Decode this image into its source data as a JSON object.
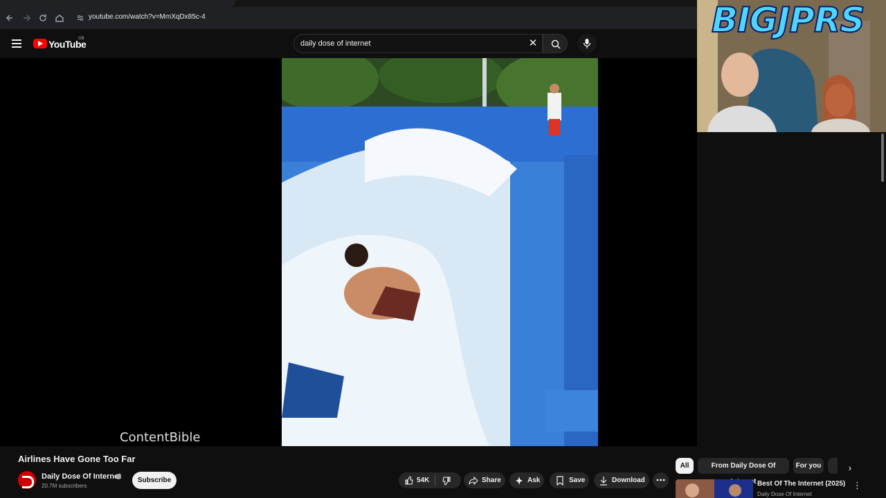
{
  "browser": {
    "url": "youtube.com/watch?v=MmXqDx85c-4",
    "icons": [
      "back-icon",
      "forward-icon",
      "reload-icon",
      "home-icon",
      "site-info-icon"
    ]
  },
  "header": {
    "logo_text": "YouTube",
    "region_code": "GB",
    "search_value": "daily dose of internet",
    "icons": [
      "menu-icon",
      "clear-icon",
      "search-icon",
      "mic-icon"
    ]
  },
  "player": {
    "watermark": "ContentBible"
  },
  "webcam": {
    "overlay_title": "BIGJPRS"
  },
  "video": {
    "title": "Airlines Have Gone Too Far",
    "channel_name": "Daily Dose Of Internet",
    "subscribers": "20.7M subscribers",
    "subscribe_label": "Subscribe"
  },
  "actions": {
    "like_count": "54K",
    "share_label": "Share",
    "ask_label": "Ask",
    "save_label": "Save",
    "download_label": "Download"
  },
  "sidebar": {
    "chips": [
      "All",
      "From Daily Dose Of Internet",
      "For you"
    ],
    "active_chip": "All",
    "recommendation": {
      "title": "Best Of The Internet (2025)",
      "channel": "Daily Dose Of Internet"
    }
  },
  "colors": {
    "background": "#0f0f0f",
    "brand_red": "#ff0000",
    "pill_bg": "#272727",
    "text_primary": "#f1f1f1",
    "text_secondary": "#aaaaaa"
  }
}
